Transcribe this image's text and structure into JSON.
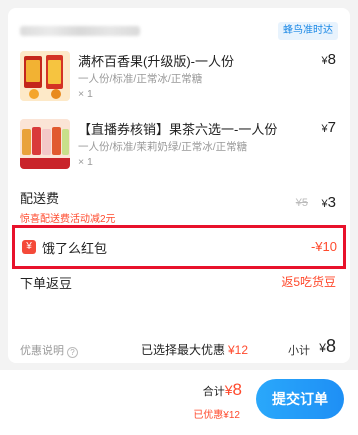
{
  "shop": {
    "delivery_badge": "蜂鸟准时达"
  },
  "items": [
    {
      "name": "满杯百香果(升级版)-一人份",
      "spec": "一人份/标准/正常冰/正常糖",
      "qty": "× 1",
      "currency": "¥",
      "price": "8"
    },
    {
      "name": "【直播券核销】果茶六选一-一人份",
      "spec": "一人份/标准/茉莉奶绿/正常冰/正常糖",
      "qty": "× 1",
      "currency": "¥",
      "price": "7"
    }
  ],
  "delivery_fee": {
    "label": "配送费",
    "promo_note": "惊喜配送费活动减2元",
    "original": "¥5",
    "currency": "¥",
    "current": "3"
  },
  "red_packet": {
    "icon_char": "¥",
    "label": "饿了么红包",
    "value": "-¥10"
  },
  "return_beans": {
    "label": "下单返豆",
    "value": "返5吃货豆"
  },
  "summary": {
    "promo_info_label": "优惠说明",
    "help_icon_char": "?",
    "max_discount_label": "已选择最大优惠",
    "max_discount_value": "¥12",
    "subtotal_label": "小计",
    "subtotal_currency": "¥",
    "subtotal_value": "8"
  },
  "bottom": {
    "total_label": "合计",
    "total_currency": "¥",
    "total_value": "8",
    "saved": "已优惠¥12",
    "submit_label": "提交订单"
  },
  "colors": {
    "accent_blue": "#1e8ff5",
    "discount_red": "#ff4a2d",
    "highlight_border": "#e8122b"
  }
}
